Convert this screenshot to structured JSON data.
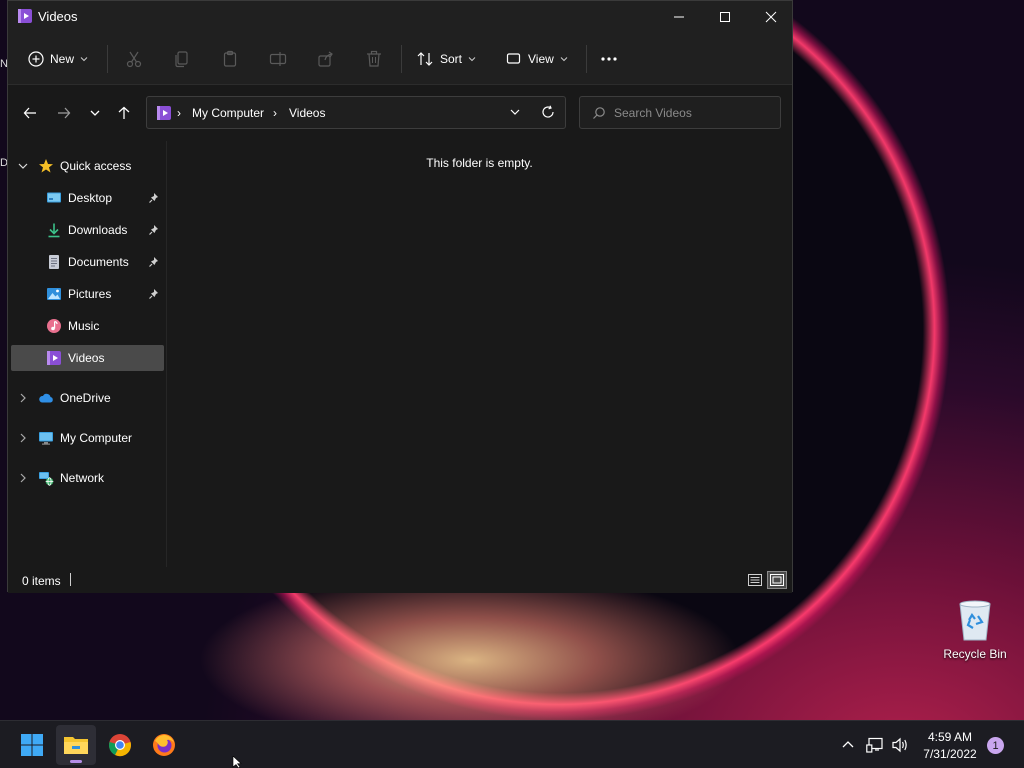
{
  "window": {
    "title": "Videos",
    "minimize_label": "Minimize",
    "maximize_label": "Maximize",
    "close_label": "Close"
  },
  "toolbar": {
    "new_label": "New",
    "sort_label": "Sort",
    "view_label": "View"
  },
  "address_bar": {
    "crumbs": [
      "My Computer",
      "Videos"
    ]
  },
  "search": {
    "placeholder": "Search Videos"
  },
  "sidebar": {
    "quick_access": "Quick access",
    "items": [
      {
        "label": "Desktop",
        "pinned": true
      },
      {
        "label": "Downloads",
        "pinned": true
      },
      {
        "label": "Documents",
        "pinned": true
      },
      {
        "label": "Pictures",
        "pinned": true
      },
      {
        "label": "Music",
        "pinned": false
      },
      {
        "label": "Videos",
        "pinned": false,
        "selected": true
      }
    ],
    "onedrive": "OneDrive",
    "my_computer": "My Computer",
    "network": "Network"
  },
  "content": {
    "empty_message": "This folder is empty."
  },
  "statusbar": {
    "item_count": "0 items"
  },
  "desktop": {
    "recycle_bin": "Recycle Bin",
    "clip_left_1": "N",
    "clip_left_2": "D"
  },
  "taskbar": {
    "time": "4:59 AM",
    "date": "7/31/2022",
    "notification_count": "1"
  },
  "colors": {
    "accent": "#b48de6",
    "videos_purple": "#8a4fd6",
    "selected_bg": "#4a4a4a",
    "window_bg": "#191919",
    "titlebar_bg": "#202020"
  }
}
